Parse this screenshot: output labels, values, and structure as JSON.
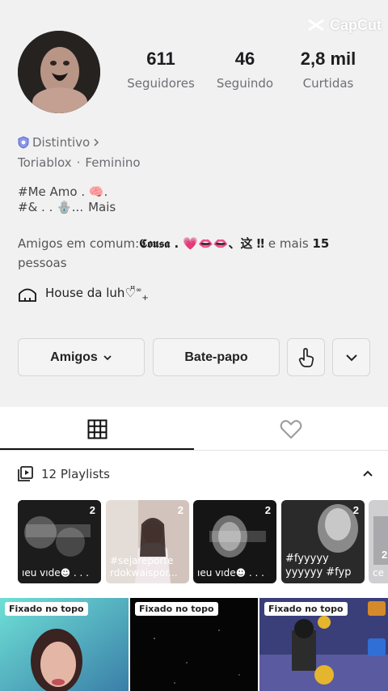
{
  "watermark": {
    "label": "CapCut",
    "icon": "capcut-logo"
  },
  "profile": {
    "avatar": "avatar",
    "stats": [
      {
        "value": "611",
        "label": "Seguidores"
      },
      {
        "value": "46",
        "label": "Seguindo"
      },
      {
        "value": "2,8 mil",
        "label": "Curtidas"
      }
    ],
    "badge": "Distintivo",
    "badge_icon": "shield-icon",
    "username": "Toriablox",
    "separator": "·",
    "gender": "Feminino",
    "bio_line1": "#Me Amo . 🧠.",
    "bio_line2": "#& . . 🪬...",
    "bio_more": "Mais",
    "mutual_prefix": "Amigos em comum:",
    "mutual_names": "𝕮𝖔𝖚𝖘𝖆 . 💗👄👄、这 ‼",
    "mutual_and_more": " e mais ",
    "mutual_count": "15",
    "mutual_suffix": "pessoas",
    "house_label": "House da luh♡̈̈",
    "house_sup": "∞",
    "house_plus": "+"
  },
  "actions": {
    "friends": "Amigos",
    "chat": "Bate-papo"
  },
  "tabs": [
    {
      "icon": "grid-icon",
      "active": true
    },
    {
      "icon": "heart-outline-icon",
      "active": false
    }
  ],
  "playlists": {
    "header": "12 Playlists",
    "items": [
      {
        "count": "2",
        "caption": "ıeu vıde☻ . . ."
      },
      {
        "count": "2",
        "caption": "#sejareporte rdokwaispor..."
      },
      {
        "count": "2",
        "caption": "ıeu vıde☻ . . ."
      },
      {
        "count": "2",
        "caption": "#fyyyyy yyyyyy #fyp"
      },
      {
        "count": "2",
        "caption": "ce"
      }
    ]
  },
  "videos": [
    {
      "pinned": "Fixado no topo"
    },
    {
      "pinned": "Fixado no topo"
    },
    {
      "pinned": "Fixado no topo"
    }
  ],
  "colors": {
    "background": "#f1f1f2",
    "badge_blue": "#5b6bd6",
    "secondary_text": "#6b6b70"
  }
}
